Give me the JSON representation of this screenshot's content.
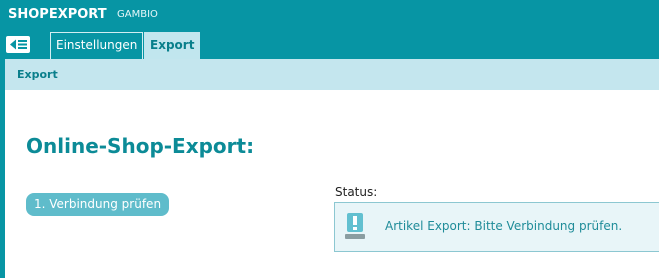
{
  "header": {
    "brand": "SHOPEXPORT",
    "platform": "GAMBIO",
    "back_icon": "back-list-icon",
    "tabs": [
      {
        "label": "Einstellungen",
        "active": false
      },
      {
        "label": "Export",
        "active": true
      }
    ]
  },
  "subnav": {
    "label": "Export"
  },
  "main": {
    "title": "Online-Shop-Export:",
    "verify_button": "1. Verbindung prüfen",
    "status": {
      "label": "Status:",
      "message": "Artikel Export: Bitte Verbindung prüfen.",
      "icon": "exclamation-icon"
    }
  },
  "colors": {
    "accent": "#0795a4",
    "subbar": "#c4e6ee",
    "button": "#5fbccb",
    "title": "#0c8b97"
  }
}
